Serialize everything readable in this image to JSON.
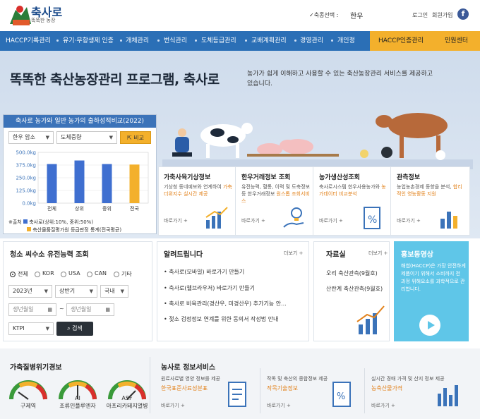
{
  "header": {
    "logo_text": "축사로",
    "logo_sub": "똑똑한 농장",
    "species_label": "✓축종선택 :",
    "species_value": "한우",
    "login": "로그인",
    "join": "회원가입",
    "facebook": "f"
  },
  "nav": {
    "items": [
      "HACCP기록관리",
      "유기·무항생제 인증",
      "개체관리",
      "번식관리",
      "도체등급관리",
      "교배계획관리",
      "경영관리",
      "개인정"
    ],
    "haccp": "HACCP인증관리",
    "civil": "민원센터"
  },
  "hero": {
    "title": "똑똑한 축산농장관리 프로그램, 축사로",
    "desc": "농가가 쉽게 이해하고 사용할 수 있는 축산농장관리 서비스를 제공하고 있습니다."
  },
  "compare": {
    "title": "축사로 농가와 일반 농가의 출하성적비교(2022)",
    "select1": "한우 암소",
    "select2": "도체중량",
    "button": "비교",
    "note_label": "※출처",
    "legend1": "축사로(상위:10%, 중위:50%)",
    "legend2": "축산물품질평가원 등급판정 통계(전국평균)"
  },
  "chart_data": {
    "type": "bar",
    "categories": [
      "전체",
      "상위",
      "중위",
      "전국"
    ],
    "yticks": [
      "500.0kg",
      "375.0kg",
      "250.0kg",
      "125.0kg",
      "0.0kg"
    ],
    "ylim": [
      0,
      500
    ],
    "series": [
      {
        "name": "축사로(상위:10%, 중위:50%)",
        "values": [
          385,
          420,
          385,
          0
        ],
        "color": "#3f6fd0"
      },
      {
        "name": "축산물품질평가원 등급판정 통계(전국평균)",
        "values": [
          0,
          0,
          0,
          380
        ],
        "color": "#f3b02c"
      }
    ]
  },
  "cards": [
    {
      "title": "가축사육기상정보",
      "desc": "기상청 동네예보와 연계하여",
      "highlight": "가축더위지수 실시간 제공",
      "more": "바로가기 +"
    },
    {
      "title": "한우거래정보 조회",
      "desc": "유전능력, 혈통, 이력 및 도축정보 등 한우거래정보",
      "highlight": "원스톱 조회서비스",
      "more": "바로가기 +"
    },
    {
      "title": "농가생산성조회",
      "desc": "축사로시스템 한우사용농가와",
      "highlight": "농가데이터 비교분석",
      "more": "바로가기 +"
    },
    {
      "title": "관측정보",
      "desc": "농업농촌경제 동향을 분석,",
      "highlight": "합리적인 영농활동 지원",
      "more": "바로가기 +"
    }
  ],
  "breed": {
    "title": "청소 씨수소 유전능력 조회",
    "radios": [
      "전체",
      "KOR",
      "USA",
      "CAN",
      "기타"
    ],
    "year": "2023년",
    "half": "상반기",
    "origin": "국내",
    "birth_from": "생년월일",
    "tilde": "~",
    "birth_to": "생년월일",
    "index": "KTPI",
    "search": "검색"
  },
  "notice": {
    "title": "알려드립니다",
    "more": "더보기 +",
    "items": [
      "축사로(모바일) 바로가기 만들기",
      "축사로(웹브라우저) 바로가기 만들기",
      "축사로 비육관리(경산우, 미경산우) 추가기능 안...",
      "젖소 검정정보 연계를 위한 동의서 작성법 안내"
    ]
  },
  "data_room": {
    "title": "자료실",
    "more": "더보기 +",
    "items": [
      "오리 축산관측(9월호)",
      "산란계 축산관측(9월호)"
    ]
  },
  "promo": {
    "title": "홍보동영상",
    "desc": "해썹(HACCP)은 가장 안전하게 제품이기 위해서 소비까지 전 과정 위해요소를 과학적으로 관리합니다."
  },
  "disease": {
    "title": "가축질병위기경보",
    "gauges": [
      {
        "label": "구제역",
        "badge": "",
        "color": "#3a9a3a"
      },
      {
        "label": "조류인플루엔자",
        "badge": "AI",
        "color": "#f3b02c"
      },
      {
        "label": "아프리카돼지열병",
        "badge": "ASF",
        "color": "#e2811a"
      }
    ]
  },
  "services": {
    "title": "농사로 정보서비스",
    "items": [
      {
        "desc": "원료사료별 영양 정보를 제공",
        "highlight": "한국표준사료성분표",
        "more": "바로가기 +"
      },
      {
        "desc": "작목 및 축산의 종합정보 제공",
        "highlight": "작목기술정보",
        "more": "바로가기 +"
      },
      {
        "desc": "실시간 경매 가격 및 산지 정보 제공",
        "highlight": "농축산물가격",
        "more": "바로가기 +"
      }
    ]
  }
}
